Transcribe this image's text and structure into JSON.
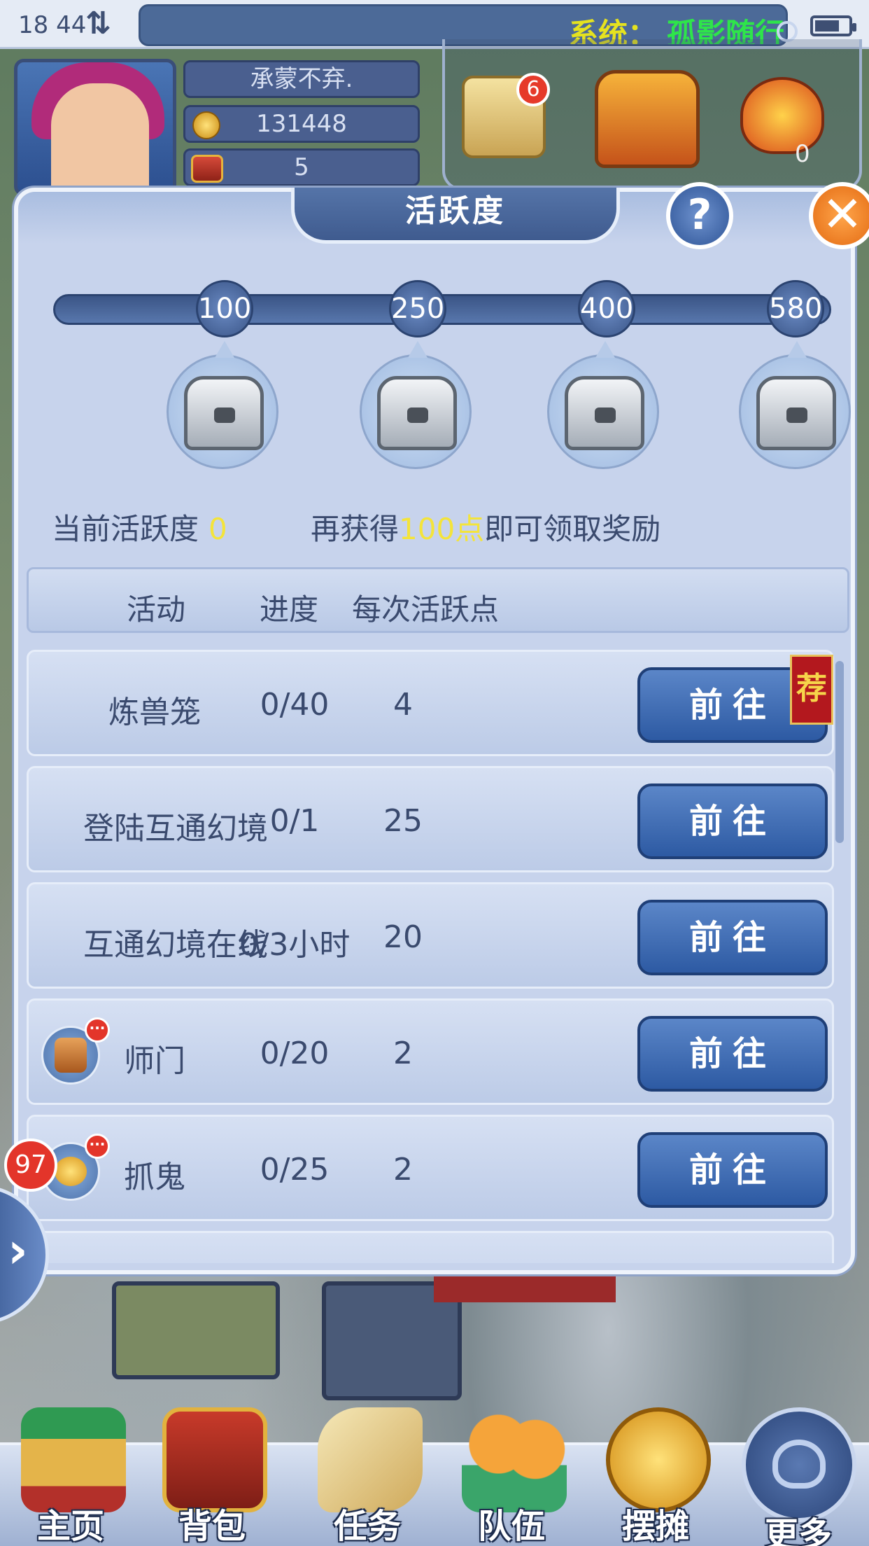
{
  "status": {
    "time": "18 44",
    "system_label": "系统：",
    "system_text": "孤影随行"
  },
  "player": {
    "name": "承蒙不弃.",
    "coins": "131448",
    "chests": "5"
  },
  "top_icons": {
    "scroll_badge": "6",
    "fire_count": "0"
  },
  "dialog": {
    "title": "活跃度",
    "milestones": [
      "100",
      "250",
      "400",
      "580"
    ],
    "current_label": "当前活跃度",
    "current_value": "0",
    "hint_prefix": "再获得",
    "hint_points": "100点",
    "hint_suffix": "即可领取奖励",
    "columns": {
      "activity": "活动",
      "progress": "进度",
      "points": "每次活跃点"
    },
    "rows": [
      {
        "name": "炼兽笼",
        "progress": "0/40",
        "points": "4",
        "button": "前往",
        "tag": "荐"
      },
      {
        "name": "登陆互通幻境",
        "progress": "0/1",
        "points": "25",
        "button": "前往"
      },
      {
        "name": "互通幻境在线",
        "progress": "0/3小时",
        "points": "20",
        "button": "前往"
      },
      {
        "name": "师门",
        "progress": "0/20",
        "points": "2",
        "button": "前往",
        "icon": "sect-icon"
      },
      {
        "name": "抓鬼",
        "progress": "0/25",
        "points": "2",
        "button": "前往",
        "icon": "gold-ingot-icon"
      }
    ]
  },
  "side": {
    "badge": "97"
  },
  "bottom_nav": [
    {
      "label": "主页",
      "icon": "home-pavilion-icon"
    },
    {
      "label": "背包",
      "icon": "backpack-chest-icon"
    },
    {
      "label": "任务",
      "icon": "quest-scroll-icon"
    },
    {
      "label": "队伍",
      "icon": "team-icon"
    },
    {
      "label": "摆摊",
      "icon": "stall-coin-icon"
    },
    {
      "label": "更多",
      "icon": "more-icon"
    }
  ],
  "colors": {
    "accent_yellow": "#f4e43a",
    "system_green": "#2ee54a",
    "button_blue": "#2d5aa3",
    "close_orange": "#e36a12"
  }
}
